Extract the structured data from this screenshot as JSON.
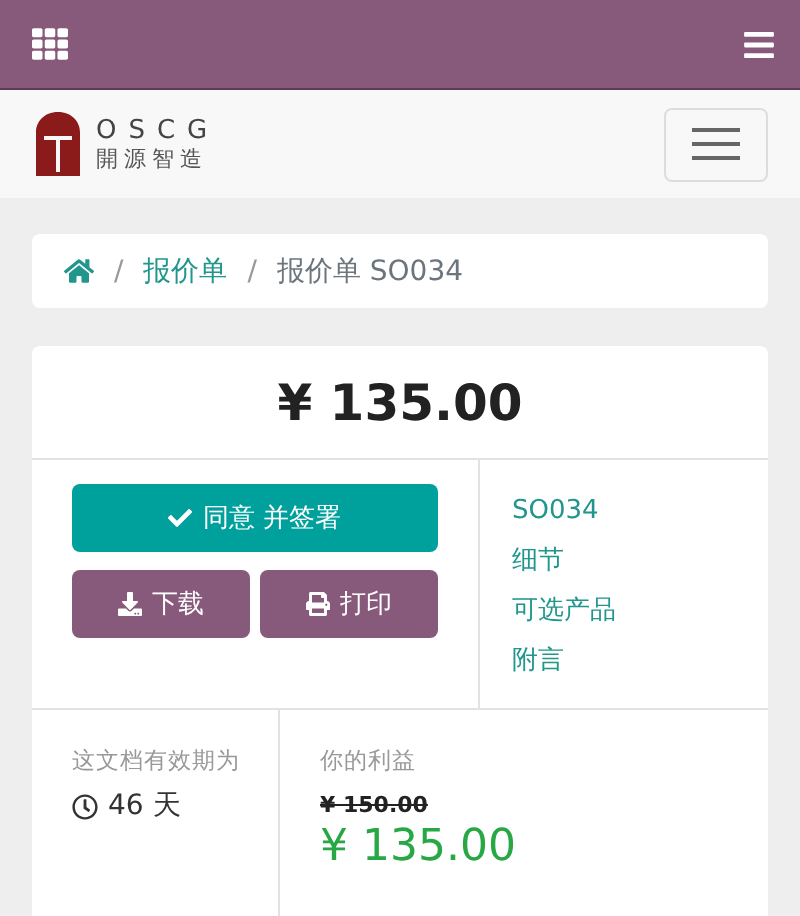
{
  "logo": {
    "name": "OSCG",
    "tagline": "開源智造"
  },
  "breadcrumb": [
    {
      "kind": "home"
    },
    {
      "kind": "separator",
      "label": "/"
    },
    {
      "kind": "link",
      "label": "报价单"
    },
    {
      "kind": "separator",
      "label": "/"
    },
    {
      "kind": "current",
      "label": "报价单 SO034"
    }
  ],
  "total": "¥ 135.00",
  "actions": {
    "primary": {
      "label": "同意 并签署"
    },
    "secondary": [
      {
        "label": "下载"
      },
      {
        "label": "打印"
      }
    ]
  },
  "nav_links": [
    "SO034",
    "细节",
    "可选产品",
    "附言"
  ],
  "validity": {
    "label": "这文档有效期为",
    "value": "46 天"
  },
  "savings": {
    "label": "你的利益",
    "old_price": "¥ 150.00",
    "new_price": "¥ 135.00"
  }
}
